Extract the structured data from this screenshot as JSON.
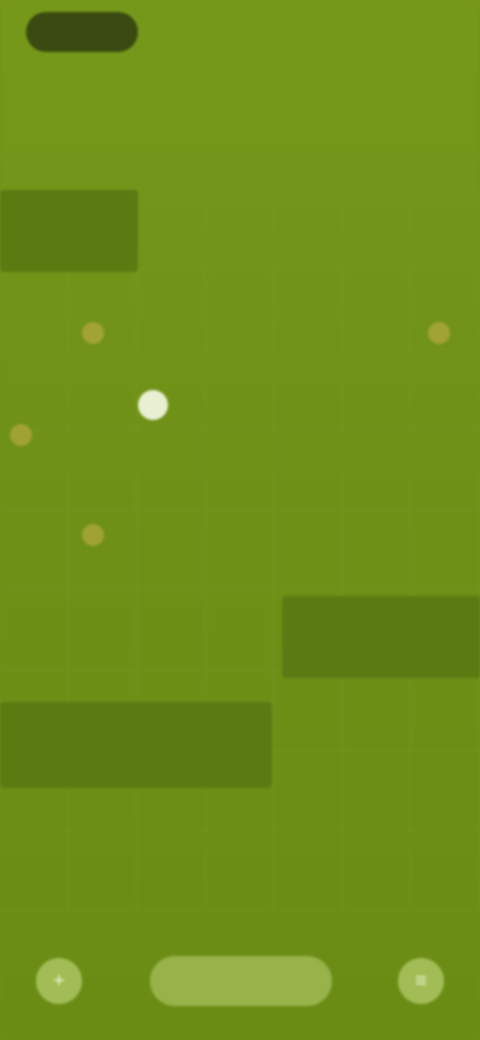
{
  "topbar": {
    "back_label": "",
    "title_secondary": "",
    "title_primary": ""
  },
  "day_header": [
    "",
    "",
    "",
    "",
    "",
    "",
    ""
  ],
  "bottom_bar": {
    "left_icon": "plus-icon",
    "center_label": "",
    "right_icon": "menu-icon"
  },
  "colors": {
    "background": "#6f9118",
    "block": "#5a7b12",
    "accent_amber": "#a9a63a",
    "highlight": "#e9f0d2"
  }
}
